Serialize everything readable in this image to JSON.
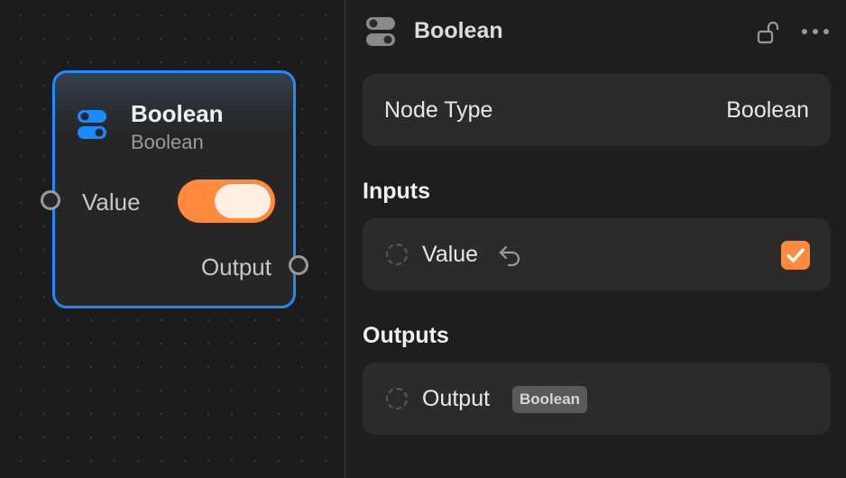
{
  "node": {
    "title": "Boolean",
    "subtitle": "Boolean",
    "input_label": "Value",
    "input_value": true,
    "output_label": "Output",
    "icon": "toggle-icon"
  },
  "inspector": {
    "title": "Boolean",
    "header_icon": "toggle-icon",
    "lock_icon": "unlock-icon",
    "more_icon": "more-horizontal-icon",
    "node_type_label": "Node Type",
    "node_type_value": "Boolean",
    "inputs_heading": "Inputs",
    "outputs_heading": "Outputs",
    "inputs": [
      {
        "label": "Value",
        "checked": true
      }
    ],
    "outputs": [
      {
        "label": "Output",
        "type": "Boolean"
      }
    ]
  },
  "colors": {
    "accent_blue": "#1a8cff",
    "accent_orange": "#ff8a3d",
    "background": "#1e1e1e",
    "card": "#2b2b2b"
  }
}
